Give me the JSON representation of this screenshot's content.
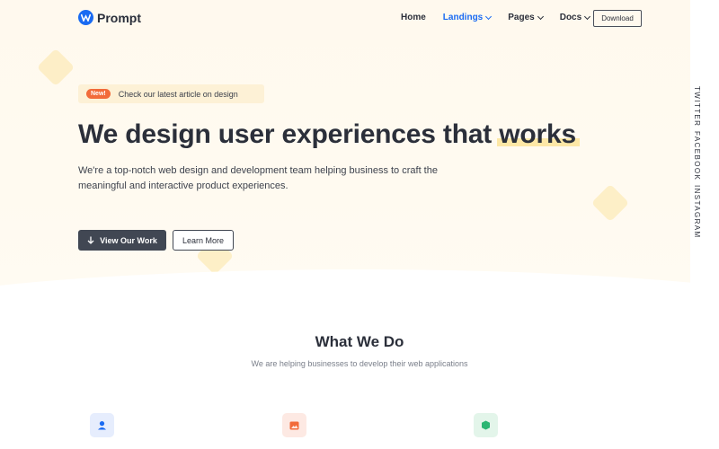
{
  "brand": {
    "name": "Prompt",
    "color": "#1a6bf2"
  },
  "nav": {
    "items": [
      {
        "label": "Home",
        "active": false,
        "dropdown": false
      },
      {
        "label": "Landings",
        "active": true,
        "dropdown": true
      },
      {
        "label": "Pages",
        "active": false,
        "dropdown": true
      },
      {
        "label": "Docs",
        "active": false,
        "dropdown": true
      }
    ],
    "download_label": "Download"
  },
  "announcement": {
    "badge": "New!",
    "text": "Check our latest article on design"
  },
  "hero": {
    "headline_main": "We design user experiences that ",
    "headline_highlight": "works",
    "lead": "We're a top-notch web design and development team helping business to craft the meaningful and interactive product experiences.",
    "primary_button": "View Our Work",
    "secondary_button": "Learn More"
  },
  "social": [
    "TWITTER",
    "FACEBOOK",
    "INSTAGRAM"
  ],
  "services": {
    "title": "What We Do",
    "subtitle": "We are helping businesses to develop their web applications",
    "features": [
      {
        "icon": "user-icon",
        "color": "#1a6bf2"
      },
      {
        "icon": "image-icon",
        "color": "#f26b3a"
      },
      {
        "icon": "shield-icon",
        "color": "#2bb673"
      }
    ]
  },
  "colors": {
    "accent": "#1a6bf2",
    "badge": "#f26b3a",
    "highlight": "#fde7a6",
    "dark_button": "#414753"
  }
}
